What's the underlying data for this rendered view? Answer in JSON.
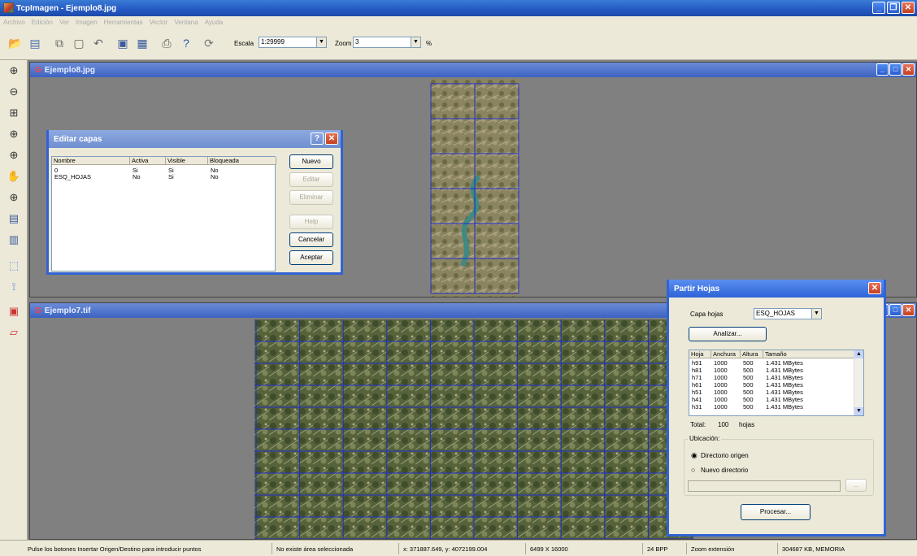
{
  "app": {
    "title": "TcpImagen - Ejemplo8.jpg"
  },
  "menu": [
    "Archivo",
    "Edición",
    "Ver",
    "Imagen",
    "Herramientas",
    "Vector",
    "Ventana",
    "Ayuda"
  ],
  "toolbar": {
    "escala_label": "Escala",
    "escala_value": "1:29999",
    "zoom_label": "Zoom",
    "zoom_value": "3",
    "percent": "%"
  },
  "windows": {
    "top_title": "Ejemplo8.jpg",
    "bottom_title": "Ejemplo7.tif"
  },
  "editar": {
    "title": "Editar capas",
    "headers": [
      "Nombre",
      "Activa",
      "Visible",
      "Bloqueada"
    ],
    "rows": [
      [
        "0",
        "Si",
        "Si",
        "No"
      ],
      [
        "ESQ_HOJAS",
        "No",
        "Si",
        "No"
      ]
    ],
    "btn_nuevo": "Nuevo",
    "btn_editar": "Editar",
    "btn_eliminar": "Eliminar",
    "btn_help": "Help",
    "btn_cancelar": "Cancelar",
    "btn_aceptar": "Aceptar"
  },
  "partir": {
    "title": "Partir Hojas",
    "capa_label": "Capa hojas",
    "capa_value": "ESQ_HOJAS",
    "analizar": "Analizar...",
    "headers": [
      "Hoja",
      "Anchura",
      "Altura",
      "Tamaño"
    ],
    "rows": [
      [
        "h91",
        "1000",
        "500",
        "1.431 MBytes"
      ],
      [
        "h81",
        "1000",
        "500",
        "1.431 MBytes"
      ],
      [
        "h71",
        "1000",
        "500",
        "1.431 MBytes"
      ],
      [
        "h61",
        "1000",
        "500",
        "1.431 MBytes"
      ],
      [
        "h51",
        "1000",
        "500",
        "1.431 MBytes"
      ],
      [
        "h41",
        "1000",
        "500",
        "1.431 MBytes"
      ],
      [
        "h31",
        "1000",
        "500",
        "1.431 MBytes"
      ]
    ],
    "total_label": "Total:",
    "total_value": "100",
    "total_unit": "hojas",
    "ubicacion": "Ubicación:",
    "opt_origen": "Directorio origen",
    "opt_nuevo": "Nuevo directorio",
    "browse": "...",
    "procesar": "Procesar..."
  },
  "status": {
    "hint": "Pulse los botones Insertar Origen/Destino para introducir puntos",
    "area": "No existe área seleccionada",
    "coords": "x: 371887.649, y: 4072199.004",
    "size": "6499 X 16000",
    "bpp": "24 BPP",
    "zoom": "Zoom extensión",
    "mem": "304687 KB, MEMORIA"
  },
  "colors": {
    "titlebar": "#2458c2",
    "grid": "#1e2ccc",
    "terrain": "#6f7a4a"
  }
}
